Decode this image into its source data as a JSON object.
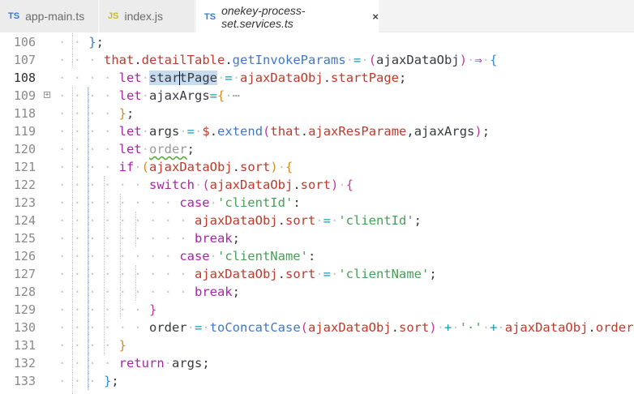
{
  "tabs": [
    {
      "lang": "TS",
      "title": "app-main.ts",
      "active": false
    },
    {
      "lang": "JS",
      "title": "index.js",
      "active": false
    },
    {
      "lang": "TS",
      "title": "onekey-process-set.services.ts",
      "active": true,
      "close": "×"
    }
  ],
  "editor": {
    "current_line": "108",
    "lines": [
      {
        "num": "106",
        "text": "};"
      },
      {
        "num": "107",
        "text": "that.detailTable.getInvokeParams = (ajaxDataObj) ⇒ {"
      },
      {
        "num": "108",
        "text": "let startPage = ajaxDataObj.startPage;"
      },
      {
        "num": "109",
        "text": "let ajaxArgs={ ⋯",
        "folded": true
      },
      {
        "num": "118",
        "text": "};"
      },
      {
        "num": "119",
        "text": "let args = $.extend(that.ajaxResParame,ajaxArgs);"
      },
      {
        "num": "120",
        "text": "let order;"
      },
      {
        "num": "121",
        "text": "if (ajaxDataObj.sort) {"
      },
      {
        "num": "122",
        "text": "switch (ajaxDataObj.sort) {"
      },
      {
        "num": "123",
        "text": "case 'clientId':"
      },
      {
        "num": "124",
        "text": "ajaxDataObj.sort = 'clientId';"
      },
      {
        "num": "125",
        "text": "break;"
      },
      {
        "num": "126",
        "text": "case 'clientName':"
      },
      {
        "num": "127",
        "text": "ajaxDataObj.sort = 'clientName';"
      },
      {
        "num": "128",
        "text": "break;"
      },
      {
        "num": "129",
        "text": "}"
      },
      {
        "num": "130",
        "text": "order = toConcatCase(ajaxDataObj.sort) + ' ' + ajaxDataObj.order;"
      },
      {
        "num": "131",
        "text": "}"
      },
      {
        "num": "132",
        "text": "return args;"
      },
      {
        "num": "133",
        "text": "};"
      }
    ]
  }
}
